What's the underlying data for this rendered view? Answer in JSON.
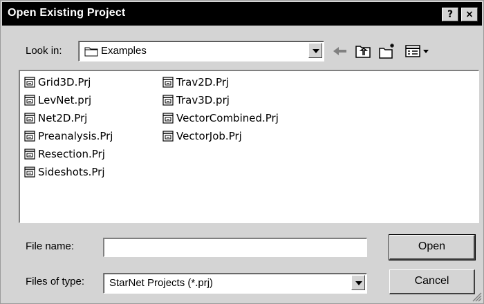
{
  "window": {
    "title": "Open Existing Project",
    "help_label": "?",
    "close_label": "×"
  },
  "toolbar": {
    "lookin_label": "Look in:",
    "lookin_value": "Examples",
    "icons": [
      "back-arrow-icon",
      "up-folder-icon",
      "new-folder-icon",
      "view-menu-icon"
    ]
  },
  "files": {
    "column1": [
      {
        "name": "Grid3D.Prj"
      },
      {
        "name": "LevNet.prj"
      },
      {
        "name": "Net2D.Prj"
      },
      {
        "name": "Preanalysis.Prj"
      },
      {
        "name": "Resection.Prj"
      },
      {
        "name": "Sideshots.Prj"
      }
    ],
    "column2": [
      {
        "name": "Trav2D.Prj"
      },
      {
        "name": "Trav3D.prj"
      },
      {
        "name": "VectorCombined.Prj"
      },
      {
        "name": "VectorJob.Prj"
      }
    ]
  },
  "form": {
    "filename_label": "File name:",
    "filename_value": "",
    "filetype_label": "Files of type:",
    "filetype_value": "StarNet Projects (*.prj)"
  },
  "buttons": {
    "open_label": "Open",
    "cancel_label": "Cancel"
  }
}
